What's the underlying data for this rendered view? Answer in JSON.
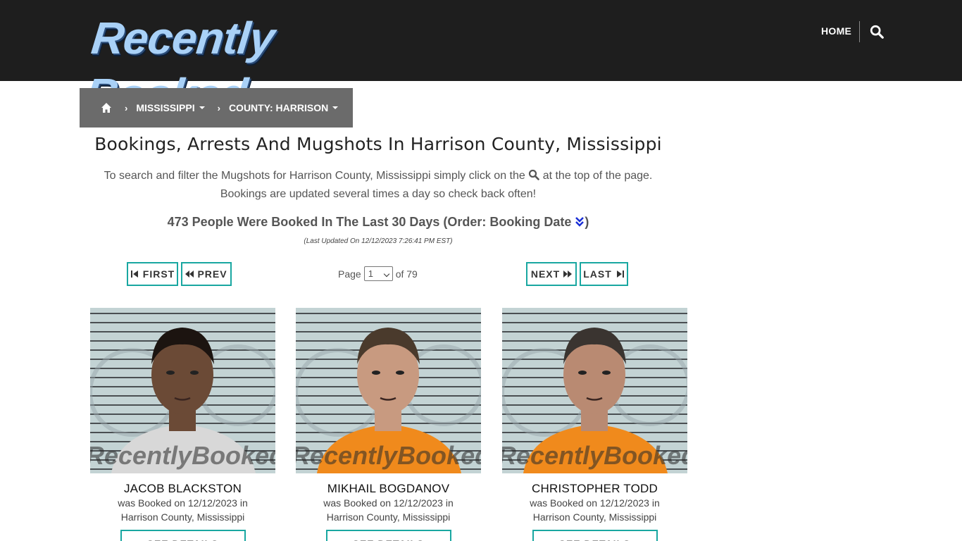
{
  "header": {
    "logo_text": "Recently Booked",
    "home_label": "HOME"
  },
  "breadcrumb": {
    "state": "MISSISSIPPI",
    "county": "COUNTY: HARRISON"
  },
  "page": {
    "title": "Bookings, Arrests And Mugshots In Harrison County, Mississippi",
    "intro_line1_before": "To search and filter the Mugshots for Harrison County, Mississippi simply click on the",
    "intro_line1_after": "at the top of the page.",
    "intro_line2": "Bookings are updated several times a day so check back often!",
    "count_text": "473 People Were Booked In The Last 30 Days (Order: Booking Date",
    "count_close": ")",
    "updated": "(Last Updated On 12/12/2023 7:26:41 PM EST)"
  },
  "pagination": {
    "first": "FIRST",
    "prev": "PREV",
    "next": "NEXT",
    "last": "LAST",
    "page_label": "Page",
    "current_page": "1",
    "of_label": "of 79"
  },
  "bookings": [
    {
      "name": "JACOB BLACKSTON",
      "line1": "was Booked on 12/12/2023 in",
      "line2": "Harrison County, Mississippi",
      "details": "SEE DETAILS",
      "shirt_color": "#d8d8d8",
      "skin": "#6b4a36",
      "hair": "#1c1410"
    },
    {
      "name": "MIKHAIL BOGDANOV",
      "line1": "was Booked on 12/12/2023 in",
      "line2": "Harrison County, Mississippi",
      "details": "SEE DETAILS",
      "shirt_color": "#f08a1c",
      "skin": "#c89a80",
      "hair": "#4a3a2c"
    },
    {
      "name": "CHRISTOPHER TODD",
      "line1": "was Booked on 12/12/2023 in",
      "line2": "Harrison County, Mississippi",
      "details": "SEE DETAILS",
      "shirt_color": "#f08a1c",
      "skin": "#b98a72",
      "hair": "#3a3430"
    }
  ],
  "watermark": "RecentlyBooked.com",
  "colors": {
    "header_bg": "#1e1e1e",
    "accent": "#19a7a1",
    "breadcrumb_bg": "#6b6b6b"
  }
}
